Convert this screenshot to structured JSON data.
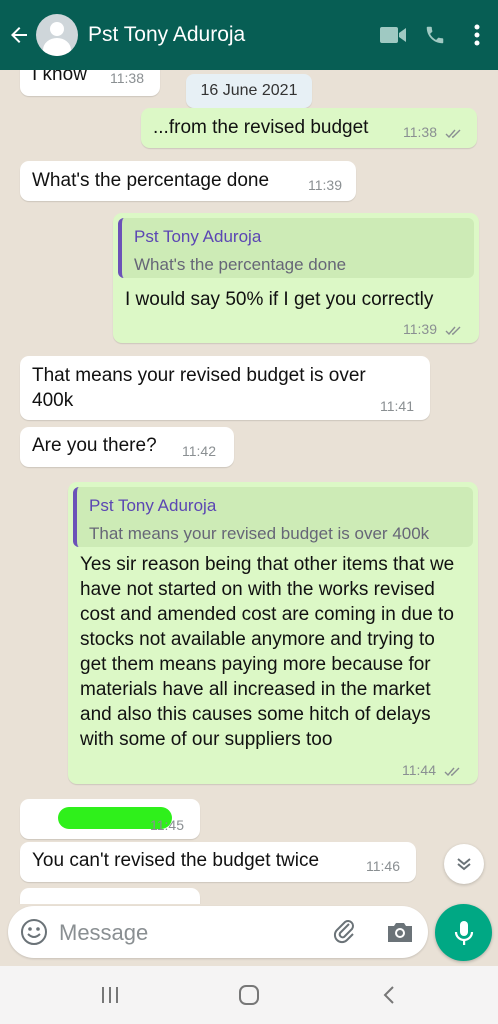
{
  "header": {
    "contact_name": "Pst Tony Aduroja",
    "back_icon": "arrow-left-icon",
    "video_icon": "video-call-icon",
    "call_icon": "phone-icon",
    "menu_icon": "more-vertical-icon"
  },
  "chat": {
    "date": "16 June 2021",
    "messages": [
      {
        "dir": "in",
        "text": "I know",
        "time": "11:38"
      },
      {
        "dir": "out",
        "text": "...from the revised budget",
        "time": "11:38"
      },
      {
        "dir": "in",
        "text": "What's the percentage done",
        "time": "11:39"
      },
      {
        "dir": "out",
        "quote_name": "Pst Tony Aduroja",
        "quote_text": "What's the percentage done",
        "text": "I would say 50% if I get you correctly",
        "time": "11:39"
      },
      {
        "dir": "in",
        "text": "That means your revised budget is over 400k",
        "time": "11:41"
      },
      {
        "dir": "in",
        "text": "Are you there?",
        "time": "11:42"
      },
      {
        "dir": "out",
        "quote_name": "Pst Tony Aduroja",
        "quote_text": "That means your revised budget is over 400k",
        "text": "Yes sir reason being that other items that we have not started on with the works revised cost and amended cost are coming in due to stocks not available anymore and trying to get them means paying more because for materials have all increased in the market and also this causes some hitch of delays with some of our suppliers too",
        "time": "11:44"
      },
      {
        "dir": "in",
        "text": "",
        "time": "11:45",
        "redacted": true
      },
      {
        "dir": "in",
        "text": "You can't revised the budget twice",
        "time": "11:46"
      }
    ]
  },
  "composer": {
    "placeholder": "Message",
    "emoji_icon": "emoji-icon",
    "attach_icon": "paperclip-icon",
    "camera_icon": "camera-icon",
    "mic_icon": "microphone-icon"
  },
  "colors": {
    "header": "#075e54",
    "outgoing": "#dcf8c6",
    "incoming": "#ffffff",
    "accent": "#00a884",
    "quote_name": "#5b46b3"
  }
}
